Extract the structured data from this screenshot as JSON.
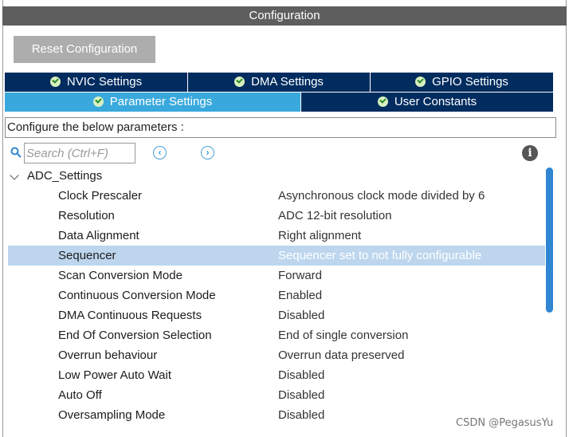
{
  "window": {
    "title": "Configuration"
  },
  "toolbar": {
    "reset_label": "Reset Configuration"
  },
  "tabs_row1": [
    {
      "label": "NVIC Settings",
      "icon": "check-circle-icon"
    },
    {
      "label": "DMA Settings",
      "icon": "check-circle-icon"
    },
    {
      "label": "GPIO Settings",
      "icon": "check-circle-icon"
    }
  ],
  "tabs_row2": [
    {
      "label": "Parameter Settings",
      "icon": "check-circle-icon",
      "active": true
    },
    {
      "label": "User Constants",
      "icon": "check-circle-icon",
      "active": false
    }
  ],
  "description": "Configure the below parameters :",
  "search": {
    "placeholder": "Search (Ctrl+F)"
  },
  "nav": {
    "prev": "‹",
    "next": "›"
  },
  "info": "i",
  "tree": {
    "group": "ADC_Settings",
    "params": [
      {
        "name": "Clock Prescaler",
        "value": "Asynchronous clock mode divided by 6"
      },
      {
        "name": "Resolution",
        "value": "ADC 12-bit resolution"
      },
      {
        "name": "Data Alignment",
        "value": "Right alignment"
      },
      {
        "name": "Sequencer",
        "value": "Sequencer set to not fully configurable"
      },
      {
        "name": "Scan Conversion Mode",
        "value": "Forward"
      },
      {
        "name": "Continuous Conversion Mode",
        "value": "Enabled"
      },
      {
        "name": "DMA Continuous Requests",
        "value": "Disabled"
      },
      {
        "name": "End Of Conversion Selection",
        "value": "End of single conversion"
      },
      {
        "name": "Overrun behaviour",
        "value": "Overrun data preserved"
      },
      {
        "name": "Low Power Auto Wait",
        "value": "Disabled"
      },
      {
        "name": "Auto Off",
        "value": "Disabled"
      },
      {
        "name": "Oversampling Mode",
        "value": "Disabled"
      }
    ],
    "selected_param": "Sequencer"
  },
  "watermark": "CSDN @PegasusYu",
  "colors": {
    "title_bar": "#5e5e5e",
    "tab_dark": "#002c5f",
    "tab_active": "#39a9dd",
    "selection": "#bdd6ee",
    "scrollbar": "#2f86d3"
  }
}
